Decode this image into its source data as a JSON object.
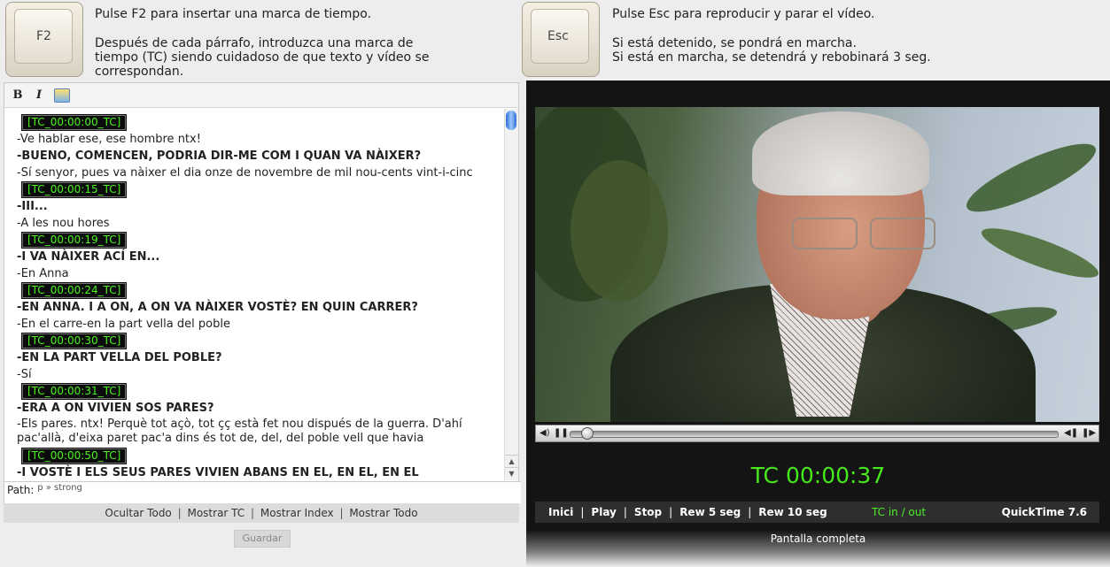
{
  "f2_panel": {
    "key_label": "F2",
    "line1": "Pulse F2 para insertar una marca de tiempo.",
    "line2": "Después de cada párrafo, introduzca una marca de\ntiempo (TC) siendo cuidadoso de que texto y vídeo se\ncorrespondan."
  },
  "esc_panel": {
    "key_label": "Esc",
    "line1": "Pulse Esc para reproducir y parar el vídeo.",
    "line2": "Si está detenido, se pondrá en marcha.\nSi está en marcha, se detendrá y rebobinará 3 seg."
  },
  "editor": {
    "toolbar": {
      "bold_label": "B",
      "italic_label": "I",
      "image_icon": "insert-image-icon"
    },
    "lines": [
      {
        "type": "tc",
        "text": "[TC_00:00:00_TC]"
      },
      {
        "type": "normal",
        "text": "-Ve hablar ese, ese hombre ntx!"
      },
      {
        "type": "bold",
        "text": "-BUENO, COMENCEN, PODRIA DIR-ME COM I QUAN VA NÀIXER?"
      },
      {
        "type": "normal",
        "text": "-Sí senyor, pues va nàixer el dia onze de novembre de mil nou-cents vint-i-cinc"
      },
      {
        "type": "tc",
        "text": "[TC_00:00:15_TC]"
      },
      {
        "type": "bold",
        "text": "-III..."
      },
      {
        "type": "normal",
        "text": "-A les nou hores"
      },
      {
        "type": "tc",
        "text": "[TC_00:00:19_TC]"
      },
      {
        "type": "bold",
        "text": "-I VA NÀIXER ACÍ EN..."
      },
      {
        "type": "normal",
        "text": "-En Anna"
      },
      {
        "type": "tc",
        "text": "[TC_00:00:24_TC]"
      },
      {
        "type": "bold",
        "text": "-EN ANNA. I A ON, A ON VA NÀIXER VOSTÈ? EN QUIN CARRER?"
      },
      {
        "type": "normal",
        "text": "-En el carre-en la part vella del poble"
      },
      {
        "type": "tc",
        "text": "[TC_00:00:30_TC]"
      },
      {
        "type": "bold",
        "text": "-EN LA PART VELLA DEL POBLE?"
      },
      {
        "type": "normal",
        "text": "-Sí"
      },
      {
        "type": "tc",
        "text": "[TC_00:00:31_TC]"
      },
      {
        "type": "bold",
        "text": "-ERA A ON VIVIEN SOS PARES?"
      },
      {
        "type": "wrap",
        "text": "-Els pares. ntx! Perquè tot açò, tot çç està fet nou dispués de la guerra. D'ahí pac'allà, d'eixa paret pac'a dins és tot de, del, del poble vell que havia"
      },
      {
        "type": "tc",
        "text": "[TC_00:00:50_TC]"
      },
      {
        "type": "bold",
        "text": "-I VOSTÈ I ELS SEUS PARES VIVIEN ABANS EN EL, EN EL, EN EL"
      }
    ],
    "path_label": "Path:",
    "path_value": "p » strong"
  },
  "links": {
    "hide_all": "Ocultar Todo",
    "show_tc": "Mostrar TC",
    "show_index": "Mostrar Index",
    "show_all": "Mostrar Todo",
    "separator": "|"
  },
  "save_label": "Guardar",
  "player": {
    "timecode": "TC 00:00:37",
    "playback_position": 0.03,
    "controls": {
      "start": "Inici",
      "play": "Play",
      "stop": "Stop",
      "rew5": "Rew 5 seg",
      "rew10": "Rew 10 seg",
      "separator": "|",
      "tc_inout": "TC in / out",
      "qt_version": "QuickTime 7.6"
    },
    "fullscreen_label": "Pantalla completa",
    "tc_color": "#47e81c"
  }
}
